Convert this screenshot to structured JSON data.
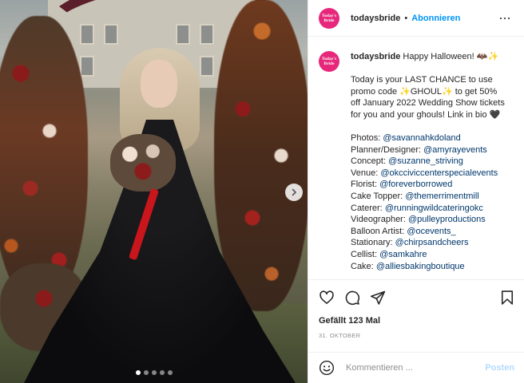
{
  "account": {
    "username": "todaysbride",
    "avatar_text": "Today's Bride",
    "separator": "•",
    "follow_label": "Abonnieren"
  },
  "caption": {
    "username": "todaysbride",
    "intro": "Happy Halloween! 🦇✨",
    "body_lines": [
      "Today is your LAST CHANCE to use",
      "promo code ✨GHOUL✨ to get 50%",
      "off January 2022 Wedding Show tickets",
      "for you and your ghouls! Link in bio 🖤"
    ],
    "credits": [
      {
        "label": "Photos:",
        "mention": "@savannahkdoland"
      },
      {
        "label": "Planner/Designer:",
        "mention": "@amyrayevents"
      },
      {
        "label": "Concept:",
        "mention": "@suzanne_striving"
      },
      {
        "label": "Venue:",
        "mention": "@okcciviccenterspecialevents"
      },
      {
        "label": "Florist:",
        "mention": "@foreverborrowed"
      },
      {
        "label": "Cake Topper:",
        "mention": "@themerrimentmill"
      },
      {
        "label": "Caterer:",
        "mention": "@runningwildcateringokc"
      },
      {
        "label": "Videographer:",
        "mention": "@pulleyproductions"
      },
      {
        "label": "Balloon Artist:",
        "mention": "@ocevents_"
      },
      {
        "label": "Stationary:",
        "mention": "@chirpsandcheers"
      },
      {
        "label": "Cellist:",
        "mention": "@samkahre"
      },
      {
        "label": "Cake:",
        "mention": "@alliesbakingboutique"
      }
    ]
  },
  "stats": {
    "likes": "Gefällt 123 Mal",
    "date": "31. OKTOBER"
  },
  "comment": {
    "placeholder": "Kommentieren ...",
    "post_label": "Posten"
  },
  "carousel": {
    "total": 5,
    "active": 1
  },
  "colors": {
    "link": "#0095f6",
    "mention": "#00376b",
    "brand": "#e6277b"
  },
  "icons": {
    "like": "heart-icon",
    "comment": "comment-icon",
    "share": "share-icon",
    "save": "bookmark-icon",
    "emoji": "emoji-icon",
    "next": "chevron-right-icon",
    "more": "more-icon"
  }
}
